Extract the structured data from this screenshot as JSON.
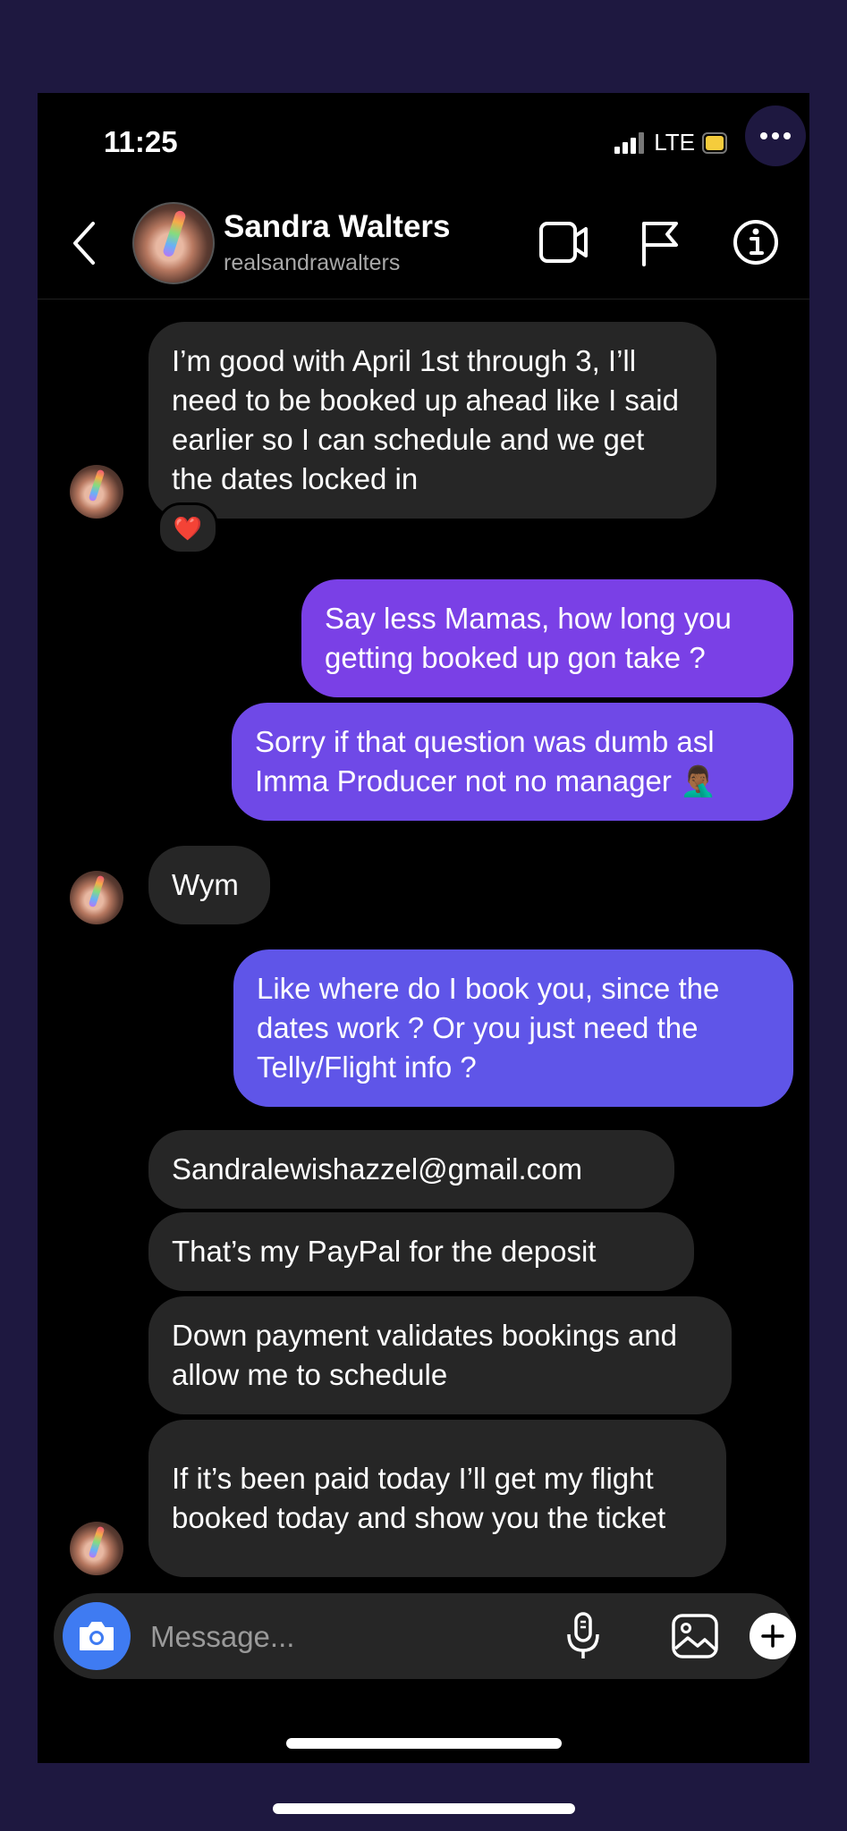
{
  "status_bar": {
    "time": "11:25",
    "network": "LTE"
  },
  "header": {
    "name": "Sandra Walters",
    "handle": "realsandrawalters"
  },
  "messages": {
    "m1": "I’m good with April 1st through 3, I’ll need to be booked up ahead like I said earlier so I can schedule and we get the dates locked in",
    "m1_reaction": "❤️",
    "m2": "Say less Mamas, how long you getting booked up gon take ?",
    "m3": "Sorry if that question was dumb asl Imma Producer not no manager 🤦🏾‍♂️",
    "m4": "Wym",
    "m5": "Like where do I book you, since the dates work ? Or you just need the Telly/Flight info ?",
    "m6": "Sandralewishazzel@gmail.com",
    "m7": "That’s my PayPal for the deposit",
    "m8": "Down payment validates bookings and allow me to schedule",
    "m9": "If it’s been paid today I’ll get my flight booked today and show you the ticket"
  },
  "composer": {
    "placeholder": "Message..."
  },
  "colors": {
    "outgoing_top": "#7b3fe6",
    "outgoing_bottom": "#5d57e8",
    "incoming": "#262626",
    "accent_camera": "#3f7bf2",
    "frame": "#1e1840"
  },
  "icons": [
    "close-icon",
    "more-icon",
    "signal-icon",
    "battery-icon",
    "back-icon",
    "video-call-icon",
    "flag-icon",
    "info-icon",
    "camera-icon",
    "microphone-icon",
    "gallery-icon",
    "plus-icon"
  ]
}
